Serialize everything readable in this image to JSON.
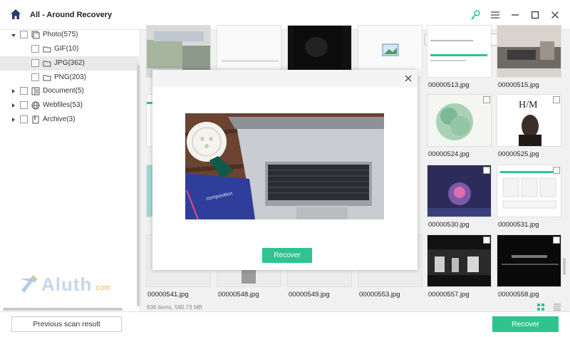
{
  "app": {
    "title": "All - Around Recovery"
  },
  "icons": {
    "home": "home-icon",
    "key": "key-icon",
    "menu": "menu-icon",
    "minimize": "minimize-icon",
    "maximize": "maximize-icon",
    "close": "close-icon",
    "search": "search-icon"
  },
  "colors": {
    "accent": "#2fc48f",
    "selected_row": "#e9e9e9"
  },
  "sidebar": {
    "items": [
      {
        "label": "Photo(575)",
        "expanded": true
      },
      {
        "label": "GIF(10)"
      },
      {
        "label": "JPG(362)",
        "selected": true
      },
      {
        "label": "PNG(203)"
      },
      {
        "label": "Document(5)",
        "expanded": false
      },
      {
        "label": "Webfiles(53)",
        "expanded": false
      },
      {
        "label": "Archive(3)",
        "expanded": false
      }
    ]
  },
  "search": {
    "placeholder": ""
  },
  "files": [
    {
      "name": ""
    },
    {
      "name": ""
    },
    {
      "name": ""
    },
    {
      "name": ""
    },
    {
      "name": "00000513.jpg"
    },
    {
      "name": "00000515.jpg"
    },
    {
      "name": "00000524.jpg"
    },
    {
      "name": "00000525.jpg"
    },
    {
      "name": "00000530.jpg"
    },
    {
      "name": "00000531.jpg"
    },
    {
      "name": "00000541.jpg"
    },
    {
      "name": "00000548.jpg"
    },
    {
      "name": "00000549.jpg"
    },
    {
      "name": "00000553.jpg"
    },
    {
      "name": "00000557.jpg"
    },
    {
      "name": "00000558.jpg"
    }
  ],
  "status": {
    "text": "636 items, 580.73 MB"
  },
  "footer": {
    "previous_label": "Previous scan result",
    "recover_label": "Recover"
  },
  "preview_modal": {
    "recover_label": "Recover",
    "image_text": "composition"
  },
  "watermark": {
    "text": "Aluth",
    "suffix": ".com"
  }
}
